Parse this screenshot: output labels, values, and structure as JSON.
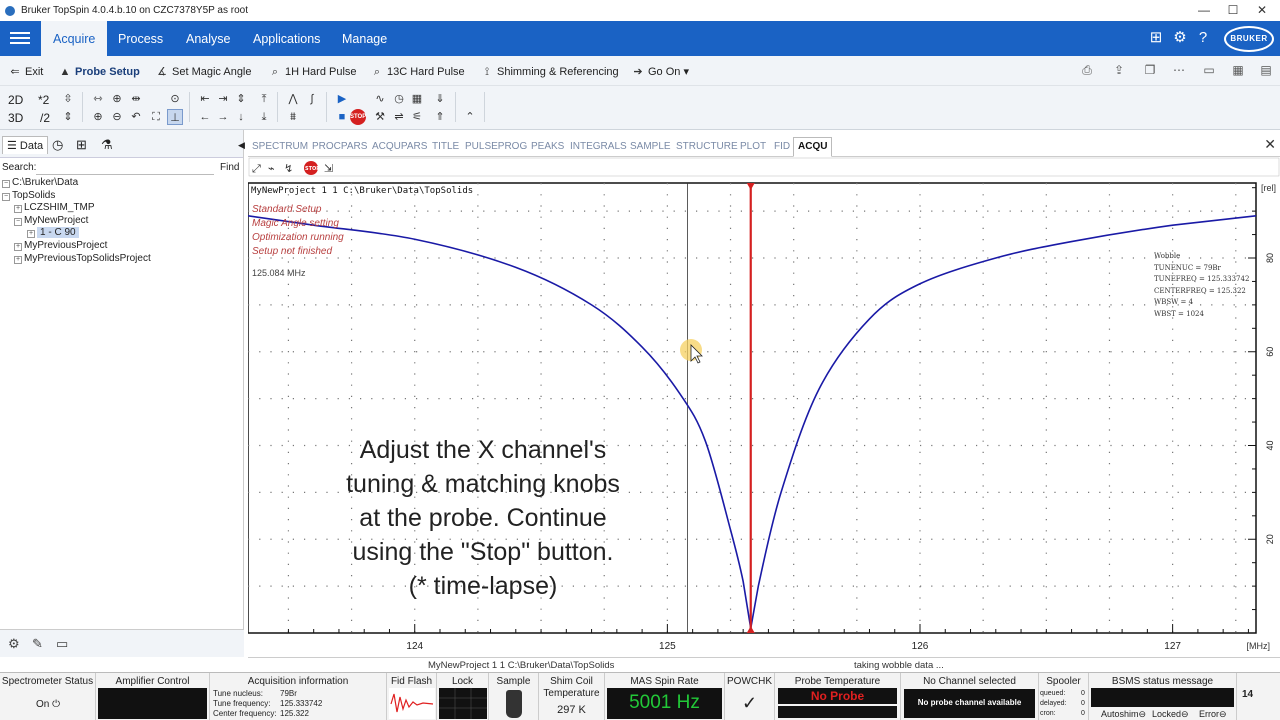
{
  "window": {
    "title": "Bruker TopSpin 4.0.4.b.10 on CZC7378Y5P as root",
    "controls": [
      "—",
      "☐",
      "✕"
    ]
  },
  "menubar": {
    "items": [
      "Acquire",
      "Process",
      "Analyse",
      "Applications",
      "Manage"
    ],
    "active": "Acquire",
    "brand": "BRUKER"
  },
  "toolbar1": {
    "exit": "Exit",
    "probe_setup": "Probe Setup",
    "magic_angle": "Set Magic Angle",
    "hard_1h": "1H Hard Pulse",
    "hard_13c": "13C Hard Pulse",
    "shimming": "Shimming & Referencing",
    "go_on": "Go On"
  },
  "toolbar2": {
    "dim_2d": "2D",
    "dim_3d": "3D",
    "times2": "*2",
    "div2": "/2"
  },
  "left_panel": {
    "tabs": [
      "Data"
    ],
    "search_label": "Search:",
    "search_value": "",
    "find_label": "Find",
    "tree": [
      {
        "label": "C:\\Bruker\\Data",
        "toggle": "−"
      },
      {
        "label": "TopSolids",
        "toggle": "−"
      },
      {
        "label": "LCZSHIM_TMP",
        "toggle": "+"
      },
      {
        "label": "MyNewProject",
        "toggle": "−"
      },
      {
        "label": "1 - C 90",
        "toggle": "+"
      },
      {
        "label": "MyPreviousProject",
        "toggle": "+"
      },
      {
        "label": "MyPreviousTopSolidsProject",
        "toggle": "+"
      }
    ]
  },
  "data_tabs": [
    "SPECTRUM",
    "PROCPARS",
    "ACQUPARS",
    "TITLE",
    "PULSEPROG",
    "PEAKS",
    "INTEGRALS",
    "SAMPLE",
    "STRUCTURE",
    "PLOT",
    "FID",
    "ACQU"
  ],
  "data_tab_active": "ACQU",
  "spectrum": {
    "title": "MyNewProject  1  1  C:\\Bruker\\Data\\TopSolids",
    "status_lines": [
      "Standard Setup",
      "Magic Angle setting",
      "Optimization running",
      "Setup not finished"
    ],
    "freq_label": "125.084 MHz",
    "wobble": {
      "heading": "Wobble",
      "lines": [
        "TUNENUC = 79Br",
        "TUNEFREQ = 125.333742",
        "CENTERFREQ = 125.322",
        "WBSW = 4",
        "WBST = 1024"
      ]
    },
    "caption": [
      "Adjust the X channel's",
      "tuning & matching knobs",
      "at the probe. Continue",
      "using the \"Stop\" button.",
      "(* time-lapse)"
    ],
    "y_unit": "[rel]",
    "x_unit": "[MHz]"
  },
  "chart_data": {
    "type": "line",
    "title": "",
    "xlabel": "[MHz]",
    "ylabel": "[rel]",
    "xlim": [
      123.34,
      127.33
    ],
    "ylim": [
      0,
      96
    ],
    "x_ticks": [
      124,
      125,
      126,
      127
    ],
    "y_ticks": [
      20,
      40,
      60,
      80
    ],
    "grid": true,
    "series": [
      {
        "x": [
          123.34,
          123.6,
          124.0,
          124.4,
          124.7,
          124.9,
          125.05,
          125.15,
          125.25,
          125.3,
          125.33,
          125.36,
          125.45,
          125.6,
          125.8,
          126.0,
          126.3,
          126.6,
          127.0,
          127.33
        ],
        "values": [
          89,
          87,
          84,
          78,
          70,
          61,
          51,
          41,
          22,
          11,
          1,
          10,
          30,
          52,
          67,
          74.5,
          80,
          83.5,
          87,
          89
        ]
      }
    ],
    "cursor_x": 125.33,
    "marker_x": 125.08
  },
  "pathbar": {
    "path": "MyNewProject  1  1  C:\\Bruker\\Data\\TopSolids",
    "status": "taking wobble data ..."
  },
  "statusbar": {
    "spectrometer": {
      "title": "Spectrometer Status",
      "value": "On"
    },
    "amplifier": {
      "title": "Amplifier Control"
    },
    "acq_info": {
      "title": "Acquisition information",
      "rows": [
        {
          "k": "Tune nucleus:",
          "v": "79Br"
        },
        {
          "k": "Tune frequency:",
          "v": "125.333742"
        },
        {
          "k": "Center frequency:",
          "v": "125.322"
        }
      ]
    },
    "fid_flash": "Fid Flash",
    "lock": "Lock",
    "sample": "Sample",
    "shim_temp": {
      "title": "Shim Coil Temperature",
      "value": "297 K"
    },
    "mas": {
      "title": "MAS Spin Rate",
      "value": "5001 Hz"
    },
    "powchk": {
      "title": "POWCHK",
      "value": "✓"
    },
    "probe_temp": {
      "title": "Probe Temperature",
      "value": "No Probe"
    },
    "channel": {
      "title": "No Channel selected",
      "value": "No probe channel available"
    },
    "spooler": {
      "title": "Spooler",
      "rows": [
        {
          "k": "queued:",
          "v": "0"
        },
        {
          "k": "delayed:",
          "v": "0"
        },
        {
          "k": "cron:",
          "v": "0"
        }
      ]
    },
    "bsms": {
      "title": "BSMS status message",
      "items": [
        "Autoshim",
        "Locked",
        "Error"
      ]
    },
    "clock": "14"
  },
  "colors": {
    "accent": "#1a62c4",
    "curve": "#1a1aa6",
    "cursor": "#d42020",
    "mas_green": "#22c838",
    "alert_red": "#e02020"
  }
}
